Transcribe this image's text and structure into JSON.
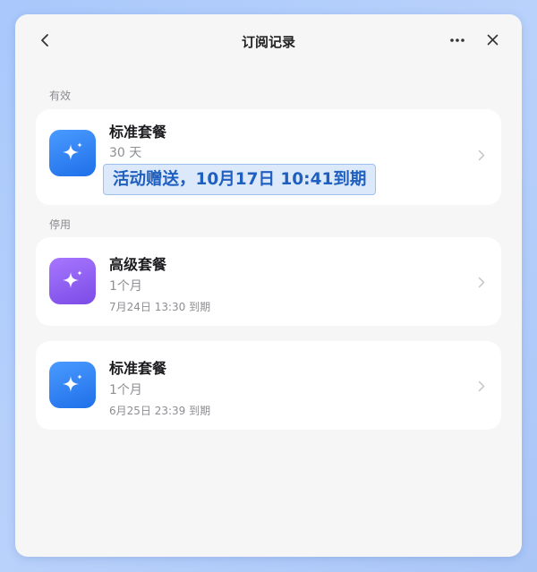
{
  "header": {
    "title": "订阅记录",
    "back_icon": "chevron-left-icon",
    "more_icon": "more-horizontal-icon",
    "close_icon": "close-icon"
  },
  "sections": [
    {
      "label": "有效",
      "items": [
        {
          "plan": "标准套餐",
          "duration": "30 天",
          "expire": "活动赠送，10月17日 10:41到期",
          "icon": "sparkle-icon",
          "icon_color": "#2f80f5",
          "highlighted": true
        }
      ]
    },
    {
      "label": "停用",
      "items": [
        {
          "plan": "高级套餐",
          "duration": "1个月",
          "expire": "7月24日 13:30 到期",
          "icon": "sparkle-icon",
          "icon_color": "#8b5cf0"
        },
        {
          "plan": "标准套餐",
          "duration": "1个月",
          "expire": "6月25日 23:39 到期",
          "icon": "sparkle-icon",
          "icon_color": "#2f80f5"
        }
      ]
    }
  ],
  "colors": {
    "background": "#b3cdf9",
    "window": "#f6f6f7",
    "card": "#ffffff",
    "highlight_fill": "#dbe9fb",
    "highlight_text": "#1f5fbf"
  }
}
